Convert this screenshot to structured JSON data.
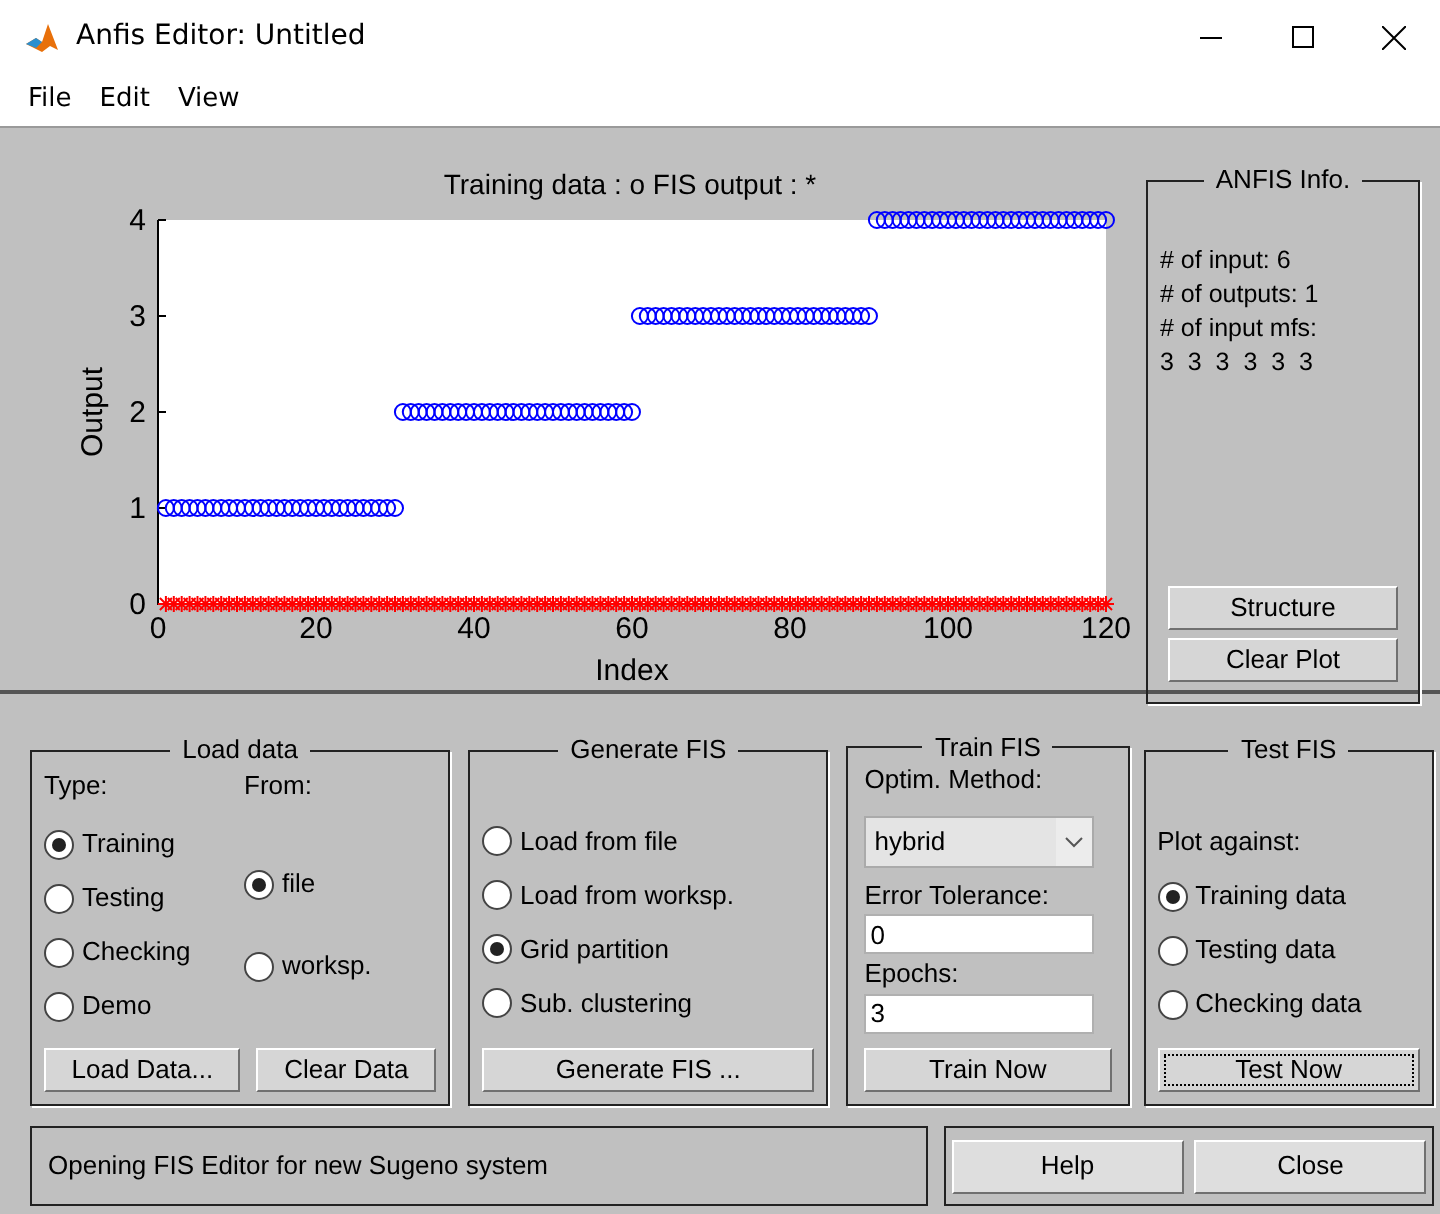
{
  "window": {
    "title": "Anfis Editor: Untitled"
  },
  "menu": [
    "File",
    "Edit",
    "View"
  ],
  "plot": {
    "chart_data": {
      "type": "scatter",
      "title": "Training data : o   FIS output : *",
      "xlabel": "Index",
      "ylabel": "Output",
      "xlim": [
        0,
        120
      ],
      "ylim": [
        0,
        4
      ],
      "xticks": [
        0,
        20,
        40,
        60,
        80,
        100,
        120
      ],
      "yticks": [
        0,
        1,
        2,
        3,
        4
      ],
      "x": [
        1,
        2,
        3,
        4,
        5,
        6,
        7,
        8,
        9,
        10,
        11,
        12,
        13,
        14,
        15,
        16,
        17,
        18,
        19,
        20,
        21,
        22,
        23,
        24,
        25,
        26,
        27,
        28,
        29,
        30,
        31,
        32,
        33,
        34,
        35,
        36,
        37,
        38,
        39,
        40,
        41,
        42,
        43,
        44,
        45,
        46,
        47,
        48,
        49,
        50,
        51,
        52,
        53,
        54,
        55,
        56,
        57,
        58,
        59,
        60,
        61,
        62,
        63,
        64,
        65,
        66,
        67,
        68,
        69,
        70,
        71,
        72,
        73,
        74,
        75,
        76,
        77,
        78,
        79,
        80,
        81,
        82,
        83,
        84,
        85,
        86,
        87,
        88,
        89,
        90,
        91,
        92,
        93,
        94,
        95,
        96,
        97,
        98,
        99,
        100,
        101,
        102,
        103,
        104,
        105,
        106,
        107,
        108,
        109,
        110,
        111,
        112,
        113,
        114,
        115,
        116,
        117,
        118,
        119,
        120
      ],
      "series": [
        {
          "marker": "circle",
          "color": "#0000ff",
          "values": [
            1,
            1,
            1,
            1,
            1,
            1,
            1,
            1,
            1,
            1,
            1,
            1,
            1,
            1,
            1,
            1,
            1,
            1,
            1,
            1,
            1,
            1,
            1,
            1,
            1,
            1,
            1,
            1,
            1,
            1,
            2,
            2,
            2,
            2,
            2,
            2,
            2,
            2,
            2,
            2,
            2,
            2,
            2,
            2,
            2,
            2,
            2,
            2,
            2,
            2,
            2,
            2,
            2,
            2,
            2,
            2,
            2,
            2,
            2,
            2,
            3,
            3,
            3,
            3,
            3,
            3,
            3,
            3,
            3,
            3,
            3,
            3,
            3,
            3,
            3,
            3,
            3,
            3,
            3,
            3,
            3,
            3,
            3,
            3,
            3,
            3,
            3,
            3,
            3,
            3,
            4,
            4,
            4,
            4,
            4,
            4,
            4,
            4,
            4,
            4,
            4,
            4,
            4,
            4,
            4,
            4,
            4,
            4,
            4,
            4,
            4,
            4,
            4,
            4,
            4,
            4,
            4,
            4,
            4,
            4
          ]
        },
        {
          "marker": "cross",
          "color": "#ff0000",
          "values": [
            0,
            0,
            0,
            0,
            0,
            0,
            0,
            0,
            0,
            0,
            0,
            0,
            0,
            0,
            0,
            0,
            0,
            0,
            0,
            0,
            0,
            0,
            0,
            0,
            0,
            0,
            0,
            0,
            0,
            0,
            0,
            0,
            0,
            0,
            0,
            0,
            0,
            0,
            0,
            0,
            0,
            0,
            0,
            0,
            0,
            0,
            0,
            0,
            0,
            0,
            0,
            0,
            0,
            0,
            0,
            0,
            0,
            0,
            0,
            0,
            0,
            0,
            0,
            0,
            0,
            0,
            0,
            0,
            0,
            0,
            0,
            0,
            0,
            0,
            0,
            0,
            0,
            0,
            0,
            0,
            0,
            0,
            0,
            0,
            0,
            0,
            0,
            0,
            0,
            0,
            0,
            0,
            0,
            0,
            0,
            0,
            0,
            0,
            0,
            0,
            0,
            0,
            0,
            0,
            0,
            0,
            0,
            0,
            0,
            0,
            0,
            0,
            0,
            0,
            0,
            0,
            0,
            0,
            0,
            0
          ]
        }
      ]
    }
  },
  "anfis_info": {
    "title": "ANFIS Info.",
    "lines": [
      "# of input: 6",
      "# of outputs: 1",
      "# of input mfs:",
      "3  3  3  3  3  3"
    ],
    "buttons": [
      "Structure",
      "Clear Plot"
    ]
  },
  "load_data": {
    "title": "Load data",
    "type_label": "Type:",
    "from_label": "From:",
    "type_options": [
      {
        "label": "Training",
        "selected": true
      },
      {
        "label": "Testing",
        "selected": false
      },
      {
        "label": "Checking",
        "selected": false
      },
      {
        "label": "Demo",
        "selected": false
      }
    ],
    "from_options": [
      {
        "label": "file",
        "selected": true
      },
      {
        "label": "worksp.",
        "selected": false
      }
    ],
    "buttons": [
      "Load Data...",
      "Clear Data"
    ]
  },
  "generate_fis": {
    "title": "Generate FIS",
    "options": [
      {
        "label": "Load from file",
        "selected": false
      },
      {
        "label": "Load from worksp.",
        "selected": false
      },
      {
        "label": "Grid partition",
        "selected": true
      },
      {
        "label": "Sub. clustering",
        "selected": false
      }
    ],
    "button": "Generate FIS ..."
  },
  "train_fis": {
    "title": "Train FIS",
    "method_label": "Optim. Method:",
    "method": "hybrid",
    "tolerance_label": "Error Tolerance:",
    "tolerance": "0",
    "epochs_label": "Epochs:",
    "epochs": "3",
    "button": "Train Now"
  },
  "test_fis": {
    "title": "Test FIS",
    "plot_against_label": "Plot against:",
    "options": [
      {
        "label": "Training data",
        "selected": true
      },
      {
        "label": "Testing data",
        "selected": false
      },
      {
        "label": "Checking data",
        "selected": false
      }
    ],
    "button": {
      "label": "Test Now",
      "focused": true
    }
  },
  "status": "Opening FIS Editor for new Sugeno system",
  "buttons": [
    "Help",
    "Close"
  ]
}
